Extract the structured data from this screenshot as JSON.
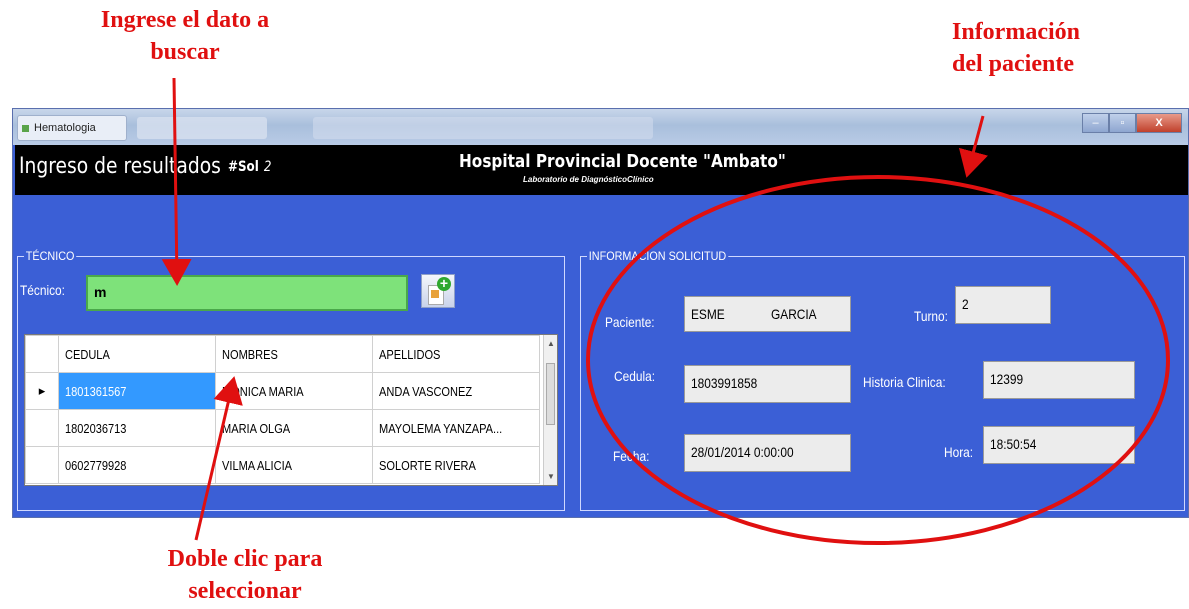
{
  "annotations": {
    "search_hint": "Ingrese el dato a buscar",
    "select_hint": "Doble clic para seleccionar",
    "patient_info_hint": "Información del paciente"
  },
  "window": {
    "title": "Hematologia"
  },
  "header": {
    "title": "Ingreso de resultados",
    "sol_label": "#Sol",
    "sol_value": "2",
    "hospital": "Hospital Provincial Docente \"Ambato\"",
    "lab": "Laboratorio de DiagnósticoClínico"
  },
  "tecnico": {
    "group_label": "TÉCNICO",
    "field_label": "Técnico:",
    "search_value": "m",
    "grid": {
      "columns": [
        "CEDULA",
        "NOMBRES",
        "APELLIDOS"
      ],
      "rows": [
        {
          "cedula": "1801361567",
          "nombres": "MONICA MARIA",
          "apellidos": "ANDA VASCONEZ"
        },
        {
          "cedula": "1802036713",
          "nombres": "MARIA OLGA",
          "apellidos": "MAYOLEMA YANZAPA..."
        },
        {
          "cedula": "0602779928",
          "nombres": "VILMA ALICIA",
          "apellidos": "SOLORTE RIVERA"
        }
      ]
    }
  },
  "info": {
    "group_label": "INFORMACION SOLICITUD",
    "paciente_label": "Paciente:",
    "paciente_nombre": "ESME",
    "paciente_apellido": "GARCIA",
    "turno_label": "Turno:",
    "turno_value": "2",
    "cedula_label": "Cedula:",
    "cedula_value": "1803991858",
    "historia_label": "Historia Clinica:",
    "historia_value": "12399",
    "fecha_label": "Fecha:",
    "fecha_value": "28/01/2014 0:00:00",
    "hora_label": "Hora:",
    "hora_value": "18:50:54"
  },
  "colors": {
    "annotation": "#e01010",
    "form_background": "#3b5fd6",
    "search_highlight": "#7ee27a",
    "selection": "#3399ff"
  }
}
